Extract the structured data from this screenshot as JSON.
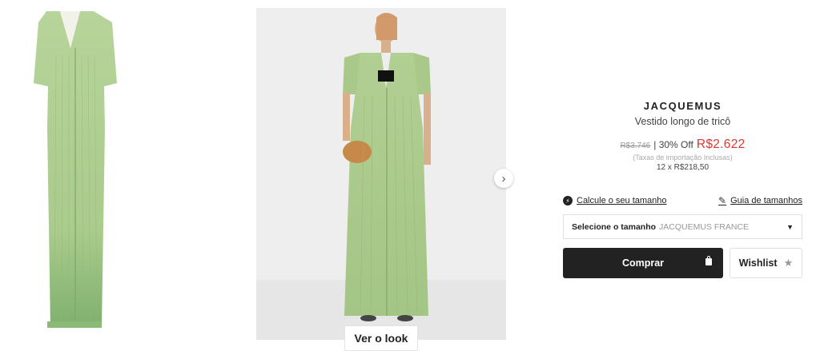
{
  "gallery": {
    "next_arrow_icon": "chevron-right-icon",
    "next_arrow_glyph": "›",
    "look_button_label": "Ver o look"
  },
  "product": {
    "brand": "JACQUEMUS",
    "name": "Vestido longo de tricô",
    "old_price": "R$3.746",
    "discount": "| 30% Off",
    "price": "R$2.622",
    "tax_note": "(Taxas de importação Inclusas)",
    "installments": "12 x R$218,50"
  },
  "size_links": {
    "calculate_label": "Calcule o seu tamanho",
    "calculate_icon": "bolt-icon",
    "guide_label": "Guia de tamanhos",
    "guide_icon": "ruler-icon"
  },
  "size_select": {
    "label": "Selecione o tamanho",
    "value": "JACQUEMUS FRANCE",
    "icon": "caret-down-icon"
  },
  "actions": {
    "buy_label": "Comprar",
    "buy_icon": "shopping-bag-icon",
    "wishlist_label": "Wishlist",
    "wishlist_icon": "star-icon",
    "wishlist_glyph": "★"
  },
  "colors": {
    "dress_green": "#a8c98a",
    "price_red": "#e0362c",
    "button_dark": "#222222"
  }
}
